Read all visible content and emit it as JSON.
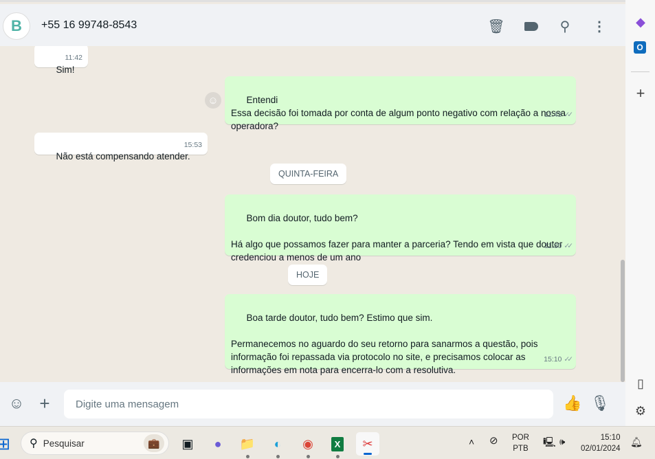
{
  "header": {
    "contact": "+55 16 99748-8543",
    "avatar_letter": "B",
    "icons": [
      "delete-icon",
      "label-icon",
      "search-icon",
      "menu-icon"
    ]
  },
  "messages": [
    {
      "dir": "in",
      "text": "Sim!",
      "time": "11:42"
    },
    {
      "dir": "out",
      "text": "Entendi\nEssa decisão foi tomada por conta de algum ponto negativo com relação a nossa operadora?",
      "time": "11:43",
      "ticks": "✓✓"
    },
    {
      "dir": "in",
      "text": "Não está compensando atender.",
      "time": "15:53"
    },
    {
      "dir": "out",
      "text": "Bom dia doutor, tudo bem?\n\nHá algo que possamos fazer para manter a parceria? Tendo em vista que doutor credenciou a menos de um ano",
      "time": "11:30",
      "ticks": "✓✓"
    },
    {
      "dir": "out",
      "text": "Boa tarde doutor, tudo bem? Estimo que sim.\n\nPermanecemos no aguardo do seu retorno para sanarmos a questão, pois informação foi repassada via protocolo no site, e precisamos colocar as informações em nota para encerra-lo com a resolutiva.",
      "time": "15:10",
      "ticks": "✓✓"
    }
  ],
  "day_chips": [
    "QUINTA-FEIRA",
    "HOJE"
  ],
  "footer": {
    "placeholder": "Digite uma mensagem"
  },
  "taskbar": {
    "search_placeholder": "Pesquisar",
    "lang_top": "POR",
    "lang_bottom": "PTB",
    "time": "15:10",
    "date": "02/01/2024"
  }
}
